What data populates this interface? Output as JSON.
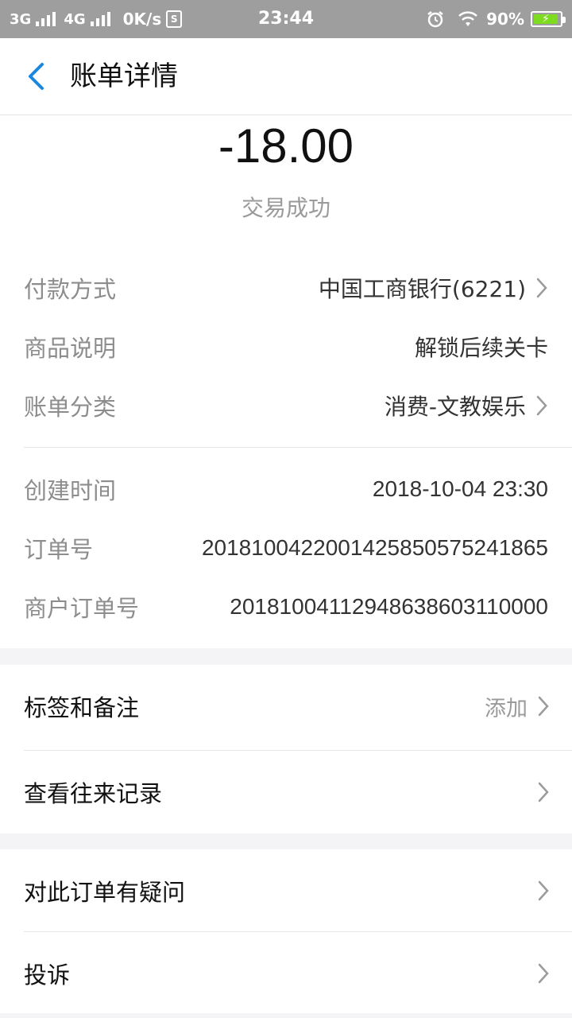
{
  "status_bar": {
    "net1": "3G",
    "net2": "4G",
    "speed": "0K/s",
    "s_icon": "S",
    "time": "23:44",
    "battery": "90%",
    "alarm_icon": "alarm-icon",
    "wifi_icon": "wifi-icon"
  },
  "nav": {
    "title": "账单详情",
    "back_icon": "back-arrow-icon",
    "accent": "#1a88e0"
  },
  "summary": {
    "amount": "-18.00",
    "status": "交易成功"
  },
  "details": [
    {
      "label": "付款方式",
      "value": "中国工商银行(6221)",
      "has_arrow": true
    },
    {
      "label": "商品说明",
      "value": "解锁后续关卡",
      "has_arrow": false
    },
    {
      "label": "账单分类",
      "value": "消费-文教娱乐",
      "has_arrow": true
    }
  ],
  "meta": [
    {
      "label": "创建时间",
      "value": "2018-10-04 23:30"
    },
    {
      "label": "订单号",
      "value": "20181004220014258505752418​65"
    },
    {
      "label": "商户订单号",
      "value": "2018100411294863860311000​0"
    }
  ],
  "group1": [
    {
      "label": "标签和备注",
      "action": "添加"
    },
    {
      "label": "查看往来记录",
      "action": ""
    }
  ],
  "group2": [
    {
      "label": "对此订单有疑问",
      "action": ""
    },
    {
      "label": "投诉",
      "action": ""
    }
  ]
}
